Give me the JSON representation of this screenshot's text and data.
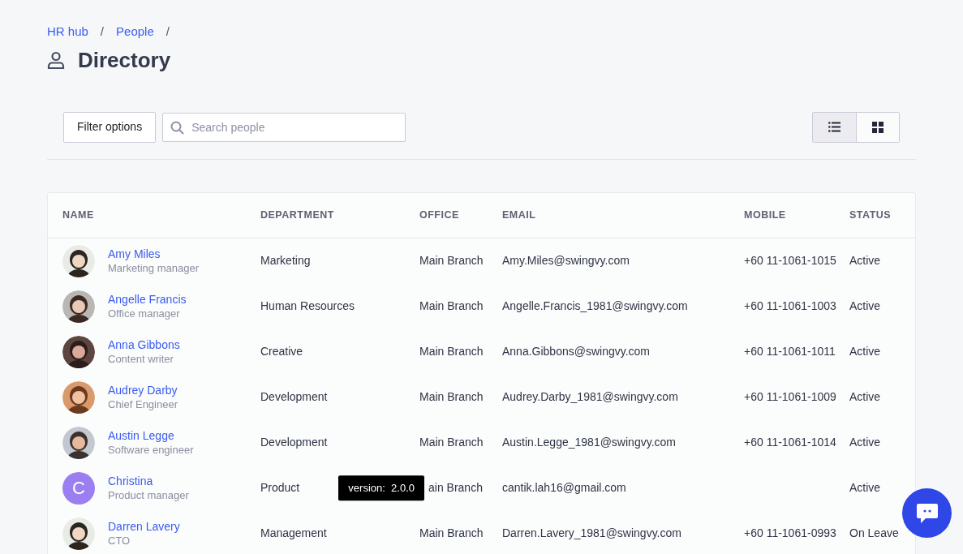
{
  "breadcrumb": [
    {
      "label": "HR hub",
      "separator": "/"
    },
    {
      "label": "People",
      "separator": "/"
    }
  ],
  "page_title": "Directory",
  "toolbar": {
    "filter_button": "Filter options",
    "search": {
      "placeholder": "Search people"
    },
    "view_toggle": [
      {
        "kind": "list",
        "selected": true
      },
      {
        "kind": "grid",
        "selected": false
      }
    ]
  },
  "table": {
    "columns": [
      "NAME",
      "DEPARTMENT",
      "OFFICE",
      "EMAIL",
      "MOBILE",
      "STATUS"
    ],
    "rows": [
      {
        "name": "Amy Miles",
        "title": "Marketing manager",
        "department": "Marketing",
        "office": "Main Branch",
        "email": "Amy.Miles@swingvy.com",
        "mobile": "+60 11-1061-1015",
        "status": "Active"
      },
      {
        "name": "Angelle Francis",
        "title": "Office manager",
        "department": "Human Resources",
        "office": "Main Branch",
        "email": "Angelle.Francis_1981@swingvy.com",
        "mobile": "+60 11-1061-1003",
        "status": "Active"
      },
      {
        "name": "Anna Gibbons",
        "title": "Content writer",
        "department": "Creative",
        "office": "Main Branch",
        "email": "Anna.Gibbons@swingvy.com",
        "mobile": "+60 11-1061-1011",
        "status": "Active"
      },
      {
        "name": "Audrey Darby",
        "title": "Chief Engineer",
        "department": "Development",
        "office": "Main Branch",
        "email": "Audrey.Darby_1981@swingvy.com",
        "mobile": "+60 11-1061-1009",
        "status": "Active"
      },
      {
        "name": "Austin Legge",
        "title": "Software engineer",
        "department": "Development",
        "office": "Main Branch",
        "email": "Austin.Legge_1981@swingvy.com",
        "mobile": "+60 11-1061-1014",
        "status": "Active"
      },
      {
        "avatar": {
          "kind": "initial",
          "letter": "C",
          "color": "#9b7ff0"
        },
        "name": "Christina",
        "title": "Product manager",
        "department": "Product",
        "office": "ain Branch",
        "tooltip": "version:  2.0.0",
        "email": "cantik.lah16@gmail.com",
        "status": "Active"
      },
      {
        "name": "Darren Lavery",
        "title": "CTO",
        "department": "Management",
        "office": "Main Branch",
        "email": "Darren.Lavery_1981@swingvy.com",
        "mobile": "+60 11-1061-0993",
        "status": "On Leave"
      }
    ]
  }
}
